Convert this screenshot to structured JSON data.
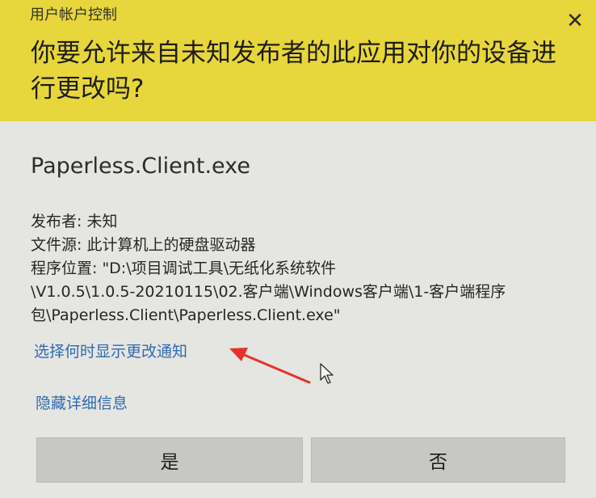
{
  "window": {
    "caption": "用户帐户控制",
    "close_icon": "close-icon"
  },
  "header": {
    "question": "你要允许来自未知发布者的此应用对你的设备进行更改吗?",
    "background": "#e7d63c"
  },
  "app": {
    "name": "Paperless.Client.exe"
  },
  "details": {
    "publisher": "发布者: 未知",
    "file_origin": "文件源: 此计算机上的硬盘驱动器",
    "program_location_line1": "程序位置: \"D:\\项目调试工具\\无纸化系统软件",
    "program_location_line2": "\\V1.0.5\\1.0.5-20210115\\02.客户端\\Windows客户端\\1-客户端程序",
    "program_location_line3": "包\\Paperless.Client\\Paperless.Client.exe\""
  },
  "links": {
    "notify_settings": "选择何时显示更改通知",
    "hide_details": "隐藏详细信息",
    "color": "#2f6bb0"
  },
  "buttons": {
    "yes": "是",
    "no": "否"
  },
  "annotation": {
    "arrow_color": "#e5332a"
  }
}
